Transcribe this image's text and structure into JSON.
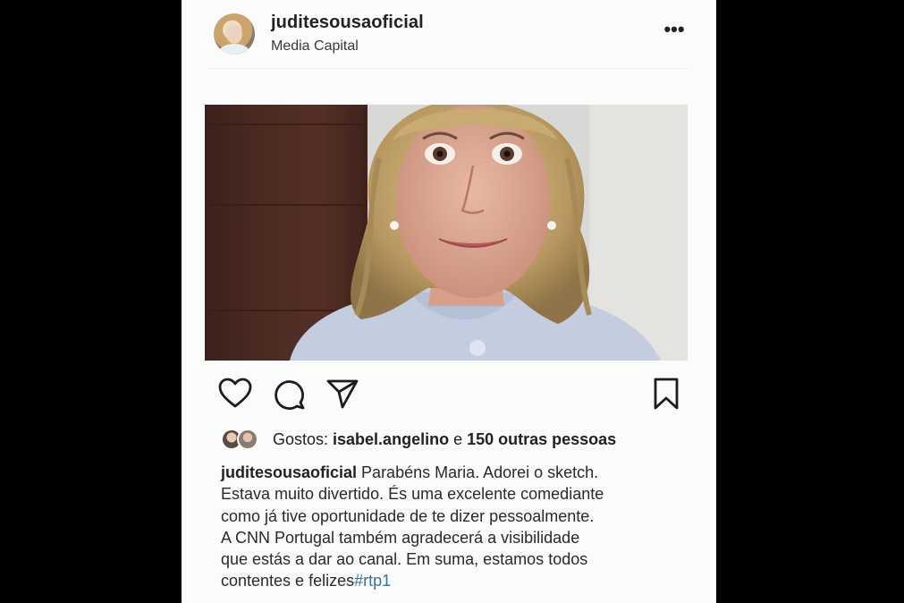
{
  "post": {
    "username": "juditesousaoficial",
    "location": "Media Capital",
    "more_label": "•••"
  },
  "icons": {
    "like": "heart-icon",
    "comment": "comment-icon",
    "share": "send-icon",
    "save": "bookmark-icon",
    "more": "more-dots-icon"
  },
  "likes": {
    "prefix": "Gostos: ",
    "user": "isabel.angelino",
    "connector": " e ",
    "others": "150 outras pessoas"
  },
  "caption": {
    "username": "juditesousaoficial",
    "lines": [
      " Parabéns Maria. Adorei o sketch.",
      "Estava muito divertido. És uma excelente comediante",
      "como já tive oportunidade de te dizer pessoalmente.",
      "A CNN Portugal também agradecerá a visibilidade",
      "que estás a dar ao canal. Em suma, estamos todos",
      "contentes e felizes"
    ],
    "hashtag": "#rtp1"
  },
  "colors": {
    "background": "#000000",
    "panel": "#fbfbfb",
    "text": "#222222",
    "hashtag": "#3e6f96"
  }
}
